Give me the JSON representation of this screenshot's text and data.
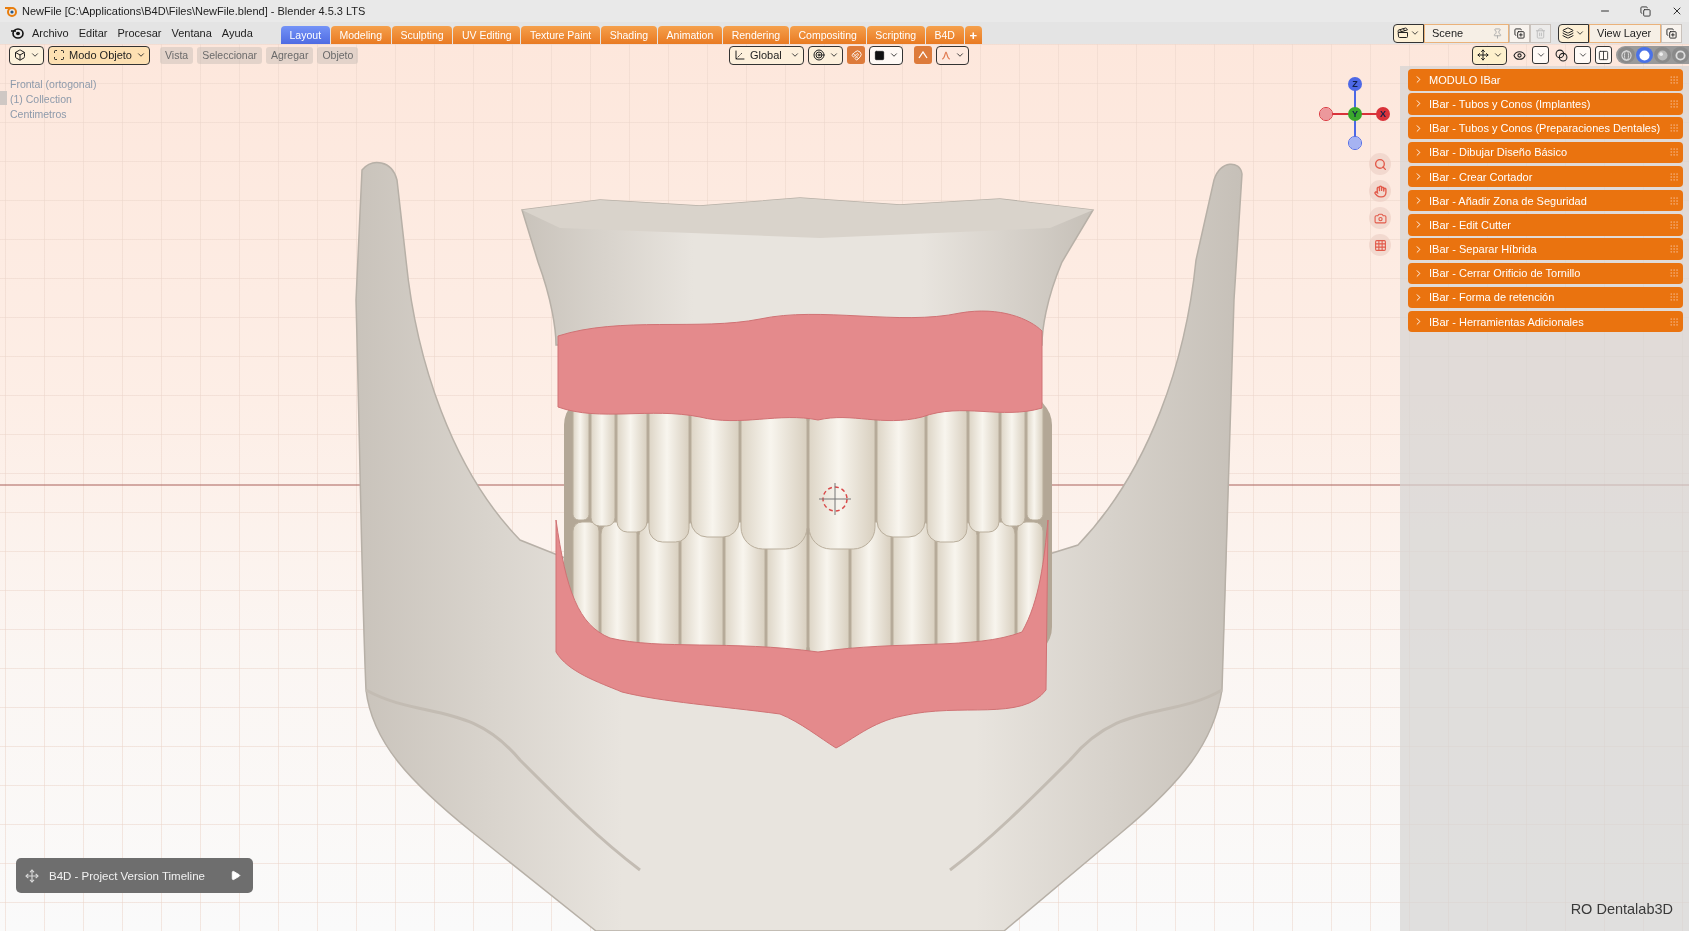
{
  "window": {
    "title": "NewFile [C:\\Applications\\B4D\\Files\\NewFile.blend] - Blender 4.5.3 LTS"
  },
  "menu": [
    "Archivo",
    "Editar",
    "Procesar",
    "Ventana",
    "Ayuda"
  ],
  "workspace_tabs": [
    {
      "label": "Layout",
      "selected": true
    },
    {
      "label": "Modeling",
      "selected": false
    },
    {
      "label": "Sculpting",
      "selected": false
    },
    {
      "label": "UV Editing",
      "selected": false
    },
    {
      "label": "Texture Paint",
      "selected": false
    },
    {
      "label": "Shading",
      "selected": false
    },
    {
      "label": "Animation",
      "selected": false
    },
    {
      "label": "Rendering",
      "selected": false
    },
    {
      "label": "Compositing",
      "selected": false
    },
    {
      "label": "Scripting",
      "selected": false
    },
    {
      "label": "B4D",
      "selected": false
    }
  ],
  "add_workspace": "+",
  "scene_selector": {
    "value": "Scene"
  },
  "view_layer_selector": {
    "value": "View Layer"
  },
  "viewport_header": {
    "mode": "Modo Objeto",
    "menus": [
      "Vista",
      "Seleccionar",
      "Agregar",
      "Objeto"
    ],
    "orientation": "Global",
    "snapping": {
      "on": true
    },
    "proportional_editing": {
      "on": true
    },
    "shading_modes": [
      {
        "kind": "wireframe",
        "selected": false
      },
      {
        "kind": "solid",
        "selected": true
      },
      {
        "kind": "material",
        "selected": false
      },
      {
        "kind": "rendered",
        "selected": false
      }
    ]
  },
  "viewport": {
    "info": [
      "Frontal (ortogonal)",
      "(1) Collection",
      "Centimetros"
    ],
    "gizmo_axes": [
      {
        "label": "Z",
        "color": "#4d68e6"
      },
      {
        "label": "Y",
        "color": "#3aa82c"
      },
      {
        "label": "X",
        "color": "#d9323a"
      }
    ],
    "corner_text": "RO Dentalab3D"
  },
  "sidebar_panels": [
    {
      "label": "MODULO IBar",
      "expanded": false
    },
    {
      "label": "IBar - Tubos y Conos (Implantes)",
      "expanded": false
    },
    {
      "label": "IBar - Tubos y Conos (Preparaciones Dentales)",
      "expanded": false
    },
    {
      "label": "IBar - Dibujar Diseño Básico",
      "expanded": false
    },
    {
      "label": "IBar - Crear Cortador",
      "expanded": false
    },
    {
      "label": "IBar - Añadir Zona de Seguridad",
      "expanded": false
    },
    {
      "label": "IBar - Edit Cutter",
      "expanded": false
    },
    {
      "label": "IBar - Separar Híbrida",
      "expanded": false
    },
    {
      "label": "IBar - Cerrar Orificio de Tornillo",
      "expanded": false
    },
    {
      "label": "IBar - Forma de retención",
      "expanded": false
    },
    {
      "label": "IBar - Herramientas Adicionales",
      "expanded": false
    }
  ],
  "timeline_button": {
    "label": "B4D - Project Version Timeline"
  }
}
